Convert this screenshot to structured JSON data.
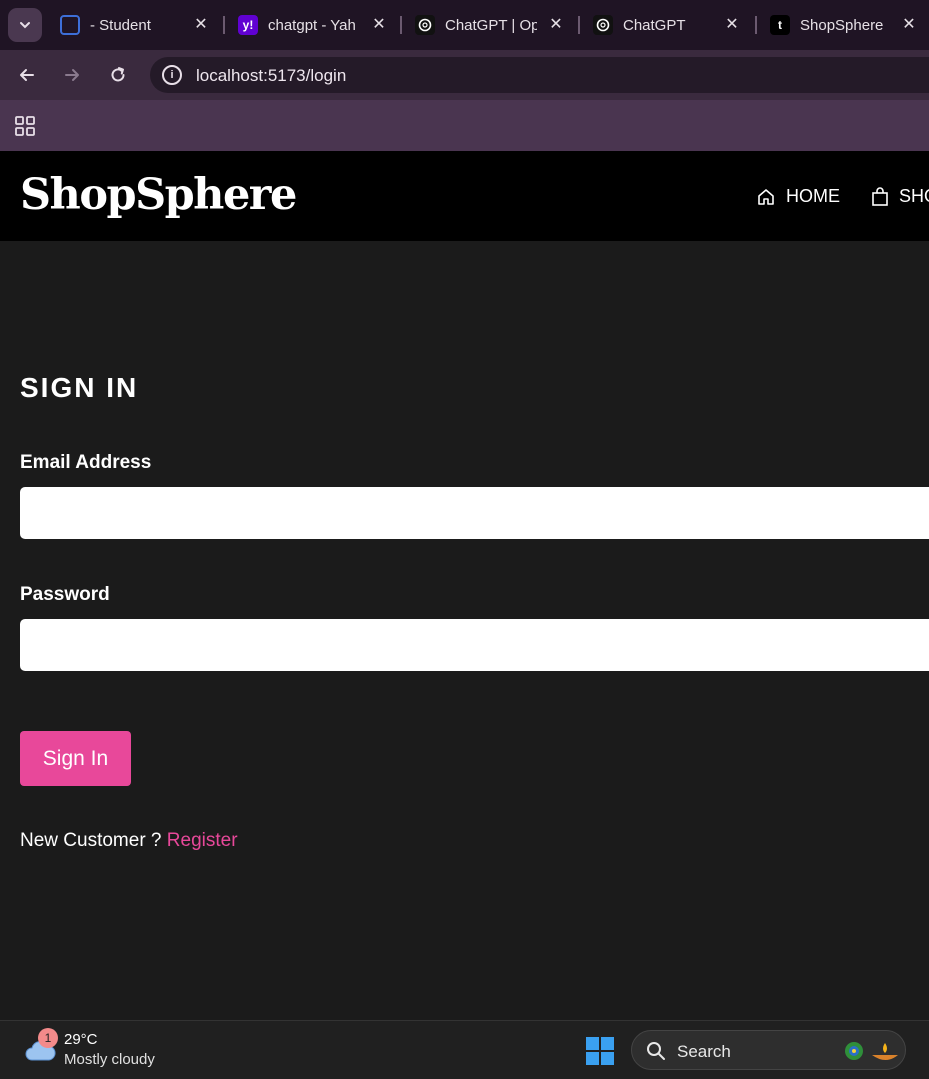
{
  "browser": {
    "tabs": [
      {
        "title": "- Student",
        "favicon": "student-portal-icon"
      },
      {
        "title": "chatgpt - Yah",
        "favicon": "yahoo-icon",
        "favicon_text": "y!"
      },
      {
        "title": "ChatGPT | Op",
        "favicon": "openai-icon"
      },
      {
        "title": "ChatGPT",
        "favicon": "openai-icon"
      },
      {
        "title": "ShopSphere",
        "favicon": "t-icon",
        "favicon_text": "t"
      }
    ],
    "close_glyph": "✕",
    "url": "localhost:5173/login",
    "info_glyph": "i"
  },
  "site": {
    "brand": "ShopSphere",
    "nav": [
      {
        "label": "HOME",
        "icon": "home-icon"
      },
      {
        "label": "SHO",
        "icon": "shopping-bag-icon"
      }
    ]
  },
  "login": {
    "heading": "SIGN IN",
    "email_label": "Email Address",
    "email_value": "",
    "password_label": "Password",
    "password_value": "",
    "submit_label": "Sign In",
    "new_customer_text": "New Customer ?",
    "register_link": "Register"
  },
  "taskbar": {
    "weather_badge": "1",
    "temperature": "29°C",
    "condition": "Mostly cloudy",
    "search_placeholder": "Search"
  },
  "colors": {
    "accent": "#e8489a",
    "page_bg": "#1b1b1b",
    "header_bg": "#000000"
  }
}
